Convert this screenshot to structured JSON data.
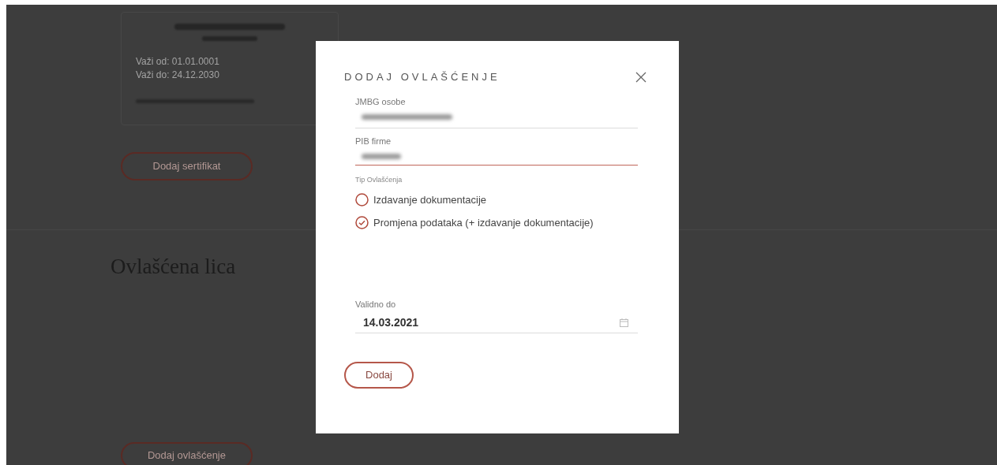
{
  "page": {
    "certificate": {
      "valid_from": "Važi od: 01.01.0001",
      "valid_to": "Važi do: 24.12.2030"
    },
    "add_certificate_button": "Dodaj sertifikat",
    "section_title": "Ovlašćena lica",
    "add_authorization_button": "Dodaj ovlašćenje"
  },
  "dialog": {
    "title": "DODAJ OVLAŠĆENJE",
    "fields": [
      {
        "label": "JMBG osobe",
        "focused": false
      },
      {
        "label": "PIB firme",
        "focused": true
      }
    ],
    "type_label": "Tip Ovlašćenja",
    "options": [
      {
        "label": "Izdavanje dokumentacije",
        "selected": false
      },
      {
        "label": "Promjena podataka (+ izdavanje dokumentacije)",
        "selected": true
      }
    ],
    "valid_until": {
      "label": "Validno do",
      "value": "14.03.2021"
    },
    "submit_button": "Dodaj"
  }
}
